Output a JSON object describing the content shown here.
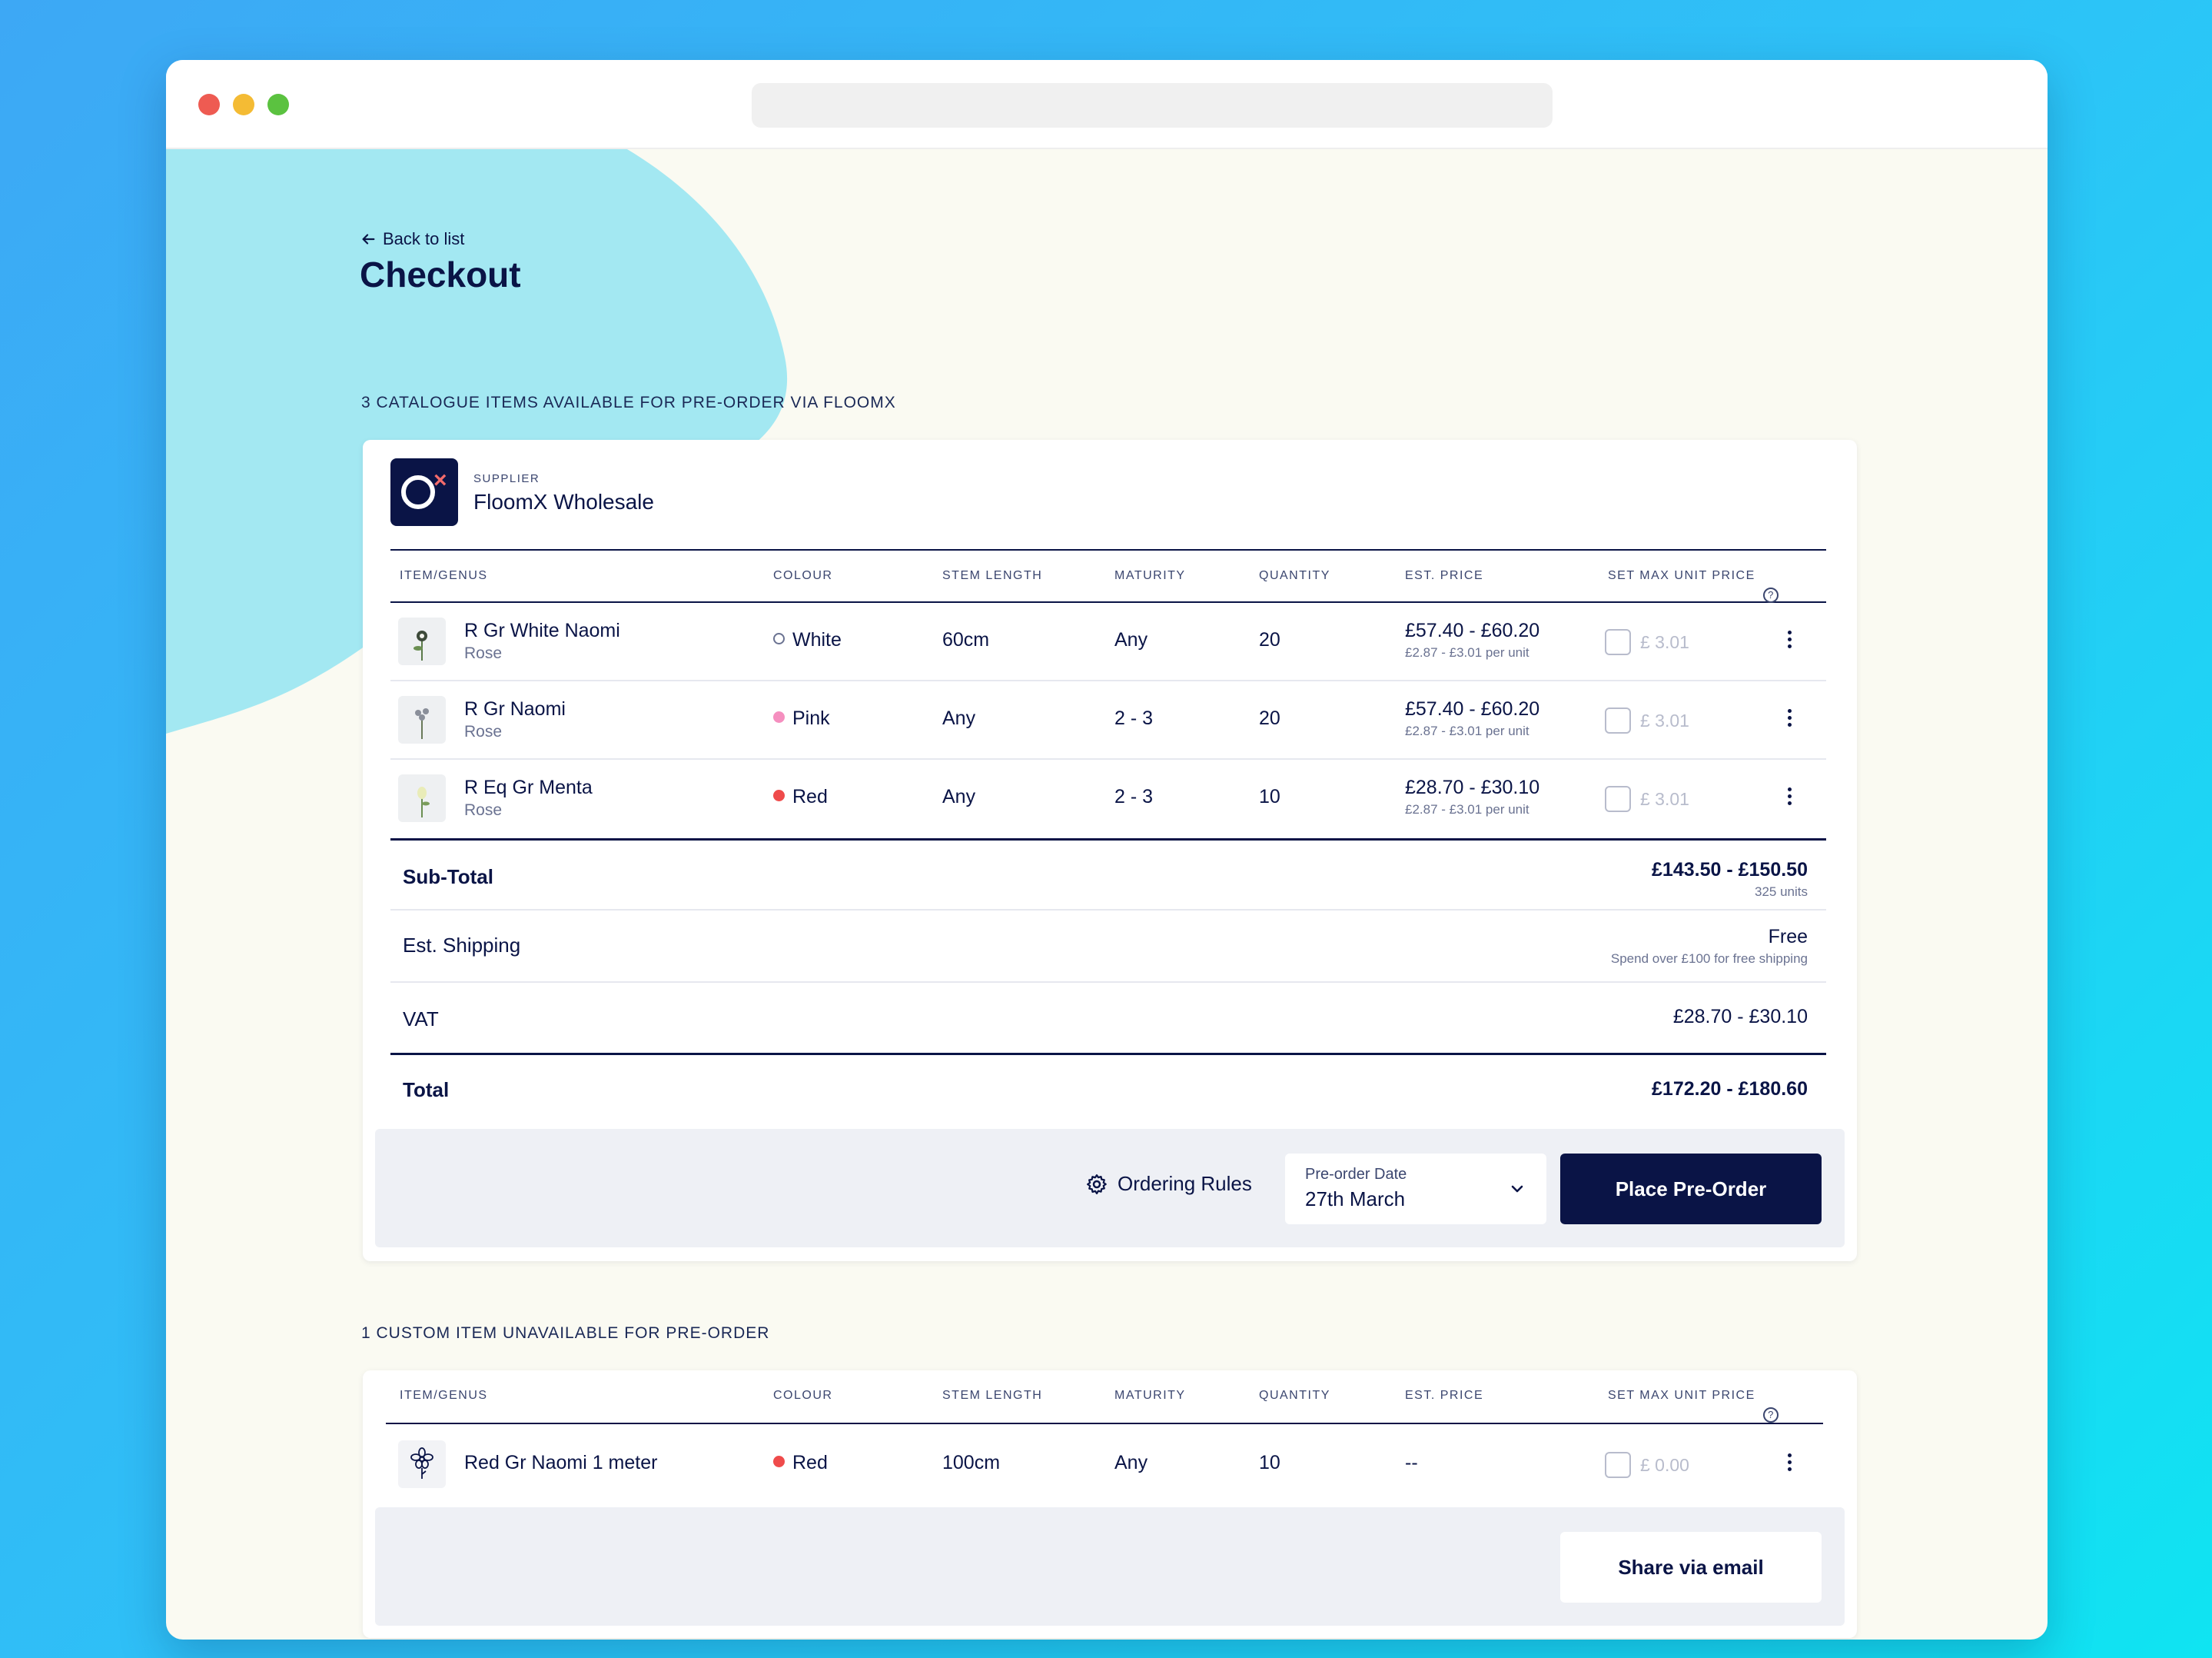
{
  "nav": {
    "back_label": "Back to list"
  },
  "page": {
    "title": "Checkout"
  },
  "available_section": {
    "label": "3 CATALOGUE ITEMS AVAILABLE FOR PRE-ORDER VIA FLOOMX",
    "supplier_kicker": "SUPPLIER",
    "supplier_name": "FloomX Wholesale",
    "columns": [
      "ITEM/GENUS",
      "COLOUR",
      "STEM LENGTH",
      "MATURITY",
      "QUANTITY",
      "EST. PRICE",
      "SET MAX UNIT PRICE"
    ],
    "help_icon_glyph": "?",
    "rows": [
      {
        "name": "R Gr White Naomi",
        "genus": "Rose",
        "colour": "White",
        "colour_hex": "#ffffff",
        "stem_length": "60cm",
        "maturity": "Any",
        "quantity": "20",
        "price": "£57.40 - £60.20",
        "price_per_unit": "£2.87 - £3.01 per unit",
        "max_price": "£ 3.01",
        "icon": "rose-photo-icon"
      },
      {
        "name": "R Gr Naomi",
        "genus": "Rose",
        "colour": "Pink",
        "colour_hex": "#f58fbf",
        "stem_length": "Any",
        "maturity": "2 - 3",
        "quantity": "20",
        "price": "£57.40 - £60.20",
        "price_per_unit": "£2.87 - £3.01 per unit",
        "max_price": "£ 3.01",
        "icon": "rose-photo-icon"
      },
      {
        "name": "R Eq Gr Menta",
        "genus": "Rose",
        "colour": "Red",
        "colour_hex": "#ef4b4b",
        "stem_length": "Any",
        "maturity": "2 - 3",
        "quantity": "10",
        "price": "£28.70 - £30.10",
        "price_per_unit": "£2.87 - £3.01 per unit",
        "max_price": "£ 3.01",
        "icon": "rose-photo-icon"
      }
    ],
    "subtotal": {
      "label": "Sub-Total",
      "value": "£143.50 - £150.50",
      "sub": "325 units"
    },
    "shipping": {
      "label": "Est. Shipping",
      "value": "Free",
      "sub": "Spend over £100 for free shipping"
    },
    "vat": {
      "label": "VAT",
      "value": "£28.70 - £30.10"
    },
    "total": {
      "label": "Total",
      "value": "£172.20 - £180.60"
    },
    "actions": {
      "ordering_rules": "Ordering Rules",
      "date_label": "Pre-order Date",
      "date_value": "27th March",
      "place_order": "Place Pre-Order"
    }
  },
  "unavailable_section": {
    "label": "1 CUSTOM ITEM UNAVAILABLE FOR PRE-ORDER",
    "columns": [
      "ITEM/GENUS",
      "COLOUR",
      "STEM LENGTH",
      "MATURITY",
      "QUANTITY",
      "EST. PRICE",
      "SET MAX UNIT PRICE"
    ],
    "help_icon_glyph": "?",
    "rows": [
      {
        "name": "Red Gr Naomi 1 meter",
        "colour": "Red",
        "colour_hex": "#ef4b4b",
        "stem_length": "100cm",
        "maturity": "Any",
        "quantity": "10",
        "price": "--",
        "max_price": "£ 0.00",
        "icon": "flower-outline-icon"
      }
    ],
    "actions": {
      "share": "Share via email"
    }
  },
  "colors": {
    "navy": "#0a1446",
    "page_bg": "#fafaf2",
    "blob": "#a3e8f2",
    "action_bar": "#eef0f5"
  }
}
